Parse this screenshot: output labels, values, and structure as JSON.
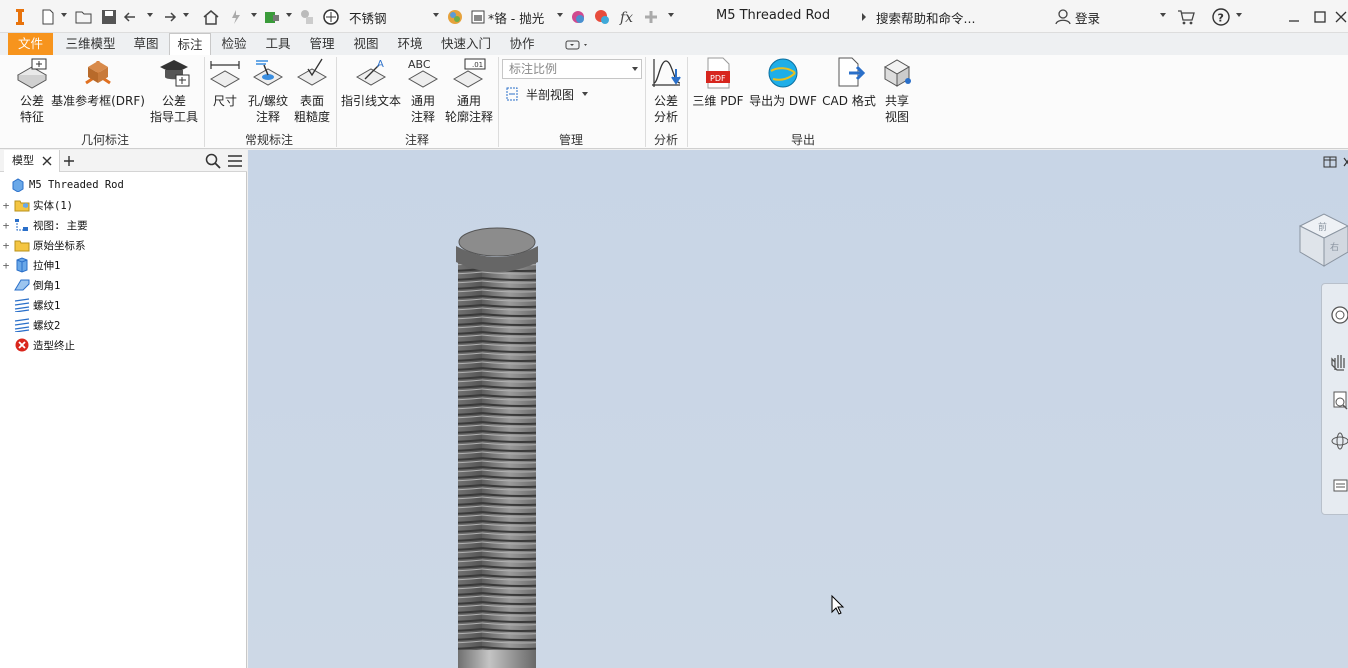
{
  "app": {
    "title": "M5 Threaded Rod",
    "material": "不锈钢",
    "appearance": "*铬 - 抛光",
    "search_placeholder": "搜索帮助和命令...",
    "login": "登录",
    "accent": "#f7941d"
  },
  "tabs": [
    "文件",
    "三维模型",
    "草图",
    "标注",
    "检验",
    "工具",
    "管理",
    "视图",
    "环境",
    "快速入门",
    "协作"
  ],
  "active_tab": "标注",
  "ribbon": {
    "buttons": [
      {
        "l1": "公差",
        "l2": "特征"
      },
      {
        "l1": "基准参考框(DRF)",
        "l2": ""
      },
      {
        "l1": "公差",
        "l2": "指导工具"
      },
      {
        "l1": "尺寸",
        "l2": ""
      },
      {
        "l1": "孔/螺纹",
        "l2": "注释"
      },
      {
        "l1": "表面",
        "l2": "粗糙度"
      },
      {
        "l1": "指引线文本",
        "l2": ""
      },
      {
        "l1": "通用",
        "l2": "注释"
      },
      {
        "l1": "通用",
        "l2": "轮廓注释"
      },
      {
        "l1": "公差",
        "l2": "分析"
      },
      {
        "l1": "三维 PDF",
        "l2": ""
      },
      {
        "l1": "导出为 DWF",
        "l2": ""
      },
      {
        "l1": "CAD 格式",
        "l2": ""
      },
      {
        "l1": "共享",
        "l2": "视图"
      }
    ],
    "panels": [
      "几何标注",
      "常规标注",
      "注释",
      "管理",
      "分析",
      "导出"
    ],
    "scale_placeholder": "标注比例",
    "section_view": "半剖视图",
    "icon_text": {
      "abc": "ABC",
      "pdf": "PDF",
      "ann": ".01"
    }
  },
  "browser": {
    "tab": "模型",
    "items": [
      {
        "label": "M5 Threaded Rod",
        "icon": "part-icon",
        "expand": ""
      },
      {
        "label": "实体(1)",
        "icon": "solid-bodies-icon",
        "expand": "+"
      },
      {
        "label": "视图: 主要",
        "icon": "view-icon",
        "expand": "+"
      },
      {
        "label": "原始坐标系",
        "icon": "folder-icon",
        "expand": "+"
      },
      {
        "label": "拉伸1",
        "icon": "extrude-icon",
        "expand": "+"
      },
      {
        "label": "倒角1",
        "icon": "chamfer-icon",
        "expand": ""
      },
      {
        "label": "螺纹1",
        "icon": "thread-icon",
        "expand": ""
      },
      {
        "label": "螺纹2",
        "icon": "thread-icon",
        "expand": ""
      },
      {
        "label": "造型终止",
        "icon": "end-of-part-icon",
        "expand": ""
      }
    ]
  },
  "viewcube": {
    "face_top": "前",
    "face_right": "右"
  }
}
